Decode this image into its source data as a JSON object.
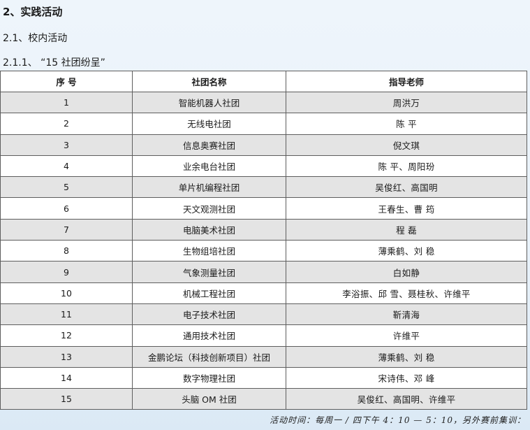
{
  "headings": {
    "h1": "2、实践活动",
    "h2": "2.1、校内活动",
    "h3": "2.1.1、 “15 社团纷呈”"
  },
  "table": {
    "headers": [
      "序 号",
      "社团名称",
      "指导老师"
    ],
    "rows": [
      {
        "no": "1",
        "name": "智能机器人社团",
        "teacher": "周洪万"
      },
      {
        "no": "2",
        "name": "无线电社团",
        "teacher": "陈  平"
      },
      {
        "no": "3",
        "name": "信息奥赛社团",
        "teacher": "倪文琪"
      },
      {
        "no": "4",
        "name": "业余电台社团",
        "teacher": "陈  平、周阳玢"
      },
      {
        "no": "5",
        "name": "单片机编程社团",
        "teacher": "吴俊红、高国明"
      },
      {
        "no": "6",
        "name": "天文观测社团",
        "teacher": "王春生、曹  筠"
      },
      {
        "no": "7",
        "name": "电脑美术社团",
        "teacher": "程  磊"
      },
      {
        "no": "8",
        "name": "生物组培社团",
        "teacher": "薄乘鹤、刘  稳"
      },
      {
        "no": "9",
        "name": "气象测量社团",
        "teacher": "白如静"
      },
      {
        "no": "10",
        "name": "机械工程社团",
        "teacher": "李浴振、邱  雪、聂桂秋、许维平"
      },
      {
        "no": "11",
        "name": "电子技术社团",
        "teacher": "靳清海"
      },
      {
        "no": "12",
        "name": "通用技术社团",
        "teacher": "许维平"
      },
      {
        "no": "13",
        "name": "金鹏论坛（科技创新项目）社团",
        "teacher": "薄乘鹤、刘  稳"
      },
      {
        "no": "14",
        "name": "数字物理社团",
        "teacher": "宋诗伟、邓  峰"
      },
      {
        "no": "15",
        "name": "头脑 OM 社团",
        "teacher": "吴俊红、高国明、许维平"
      }
    ]
  },
  "footer_note": "活动时间：每周一 / 四下午 4：10 — 5：10，另外赛前集训："
}
